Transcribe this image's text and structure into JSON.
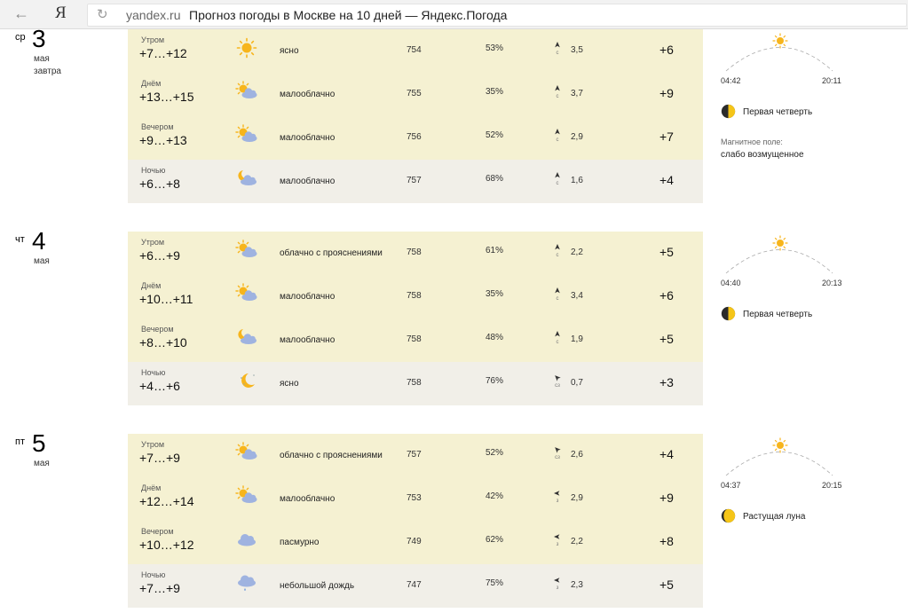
{
  "browser": {
    "back_icon": "back-arrow-icon",
    "logo": "Я",
    "reload_icon": "reload-icon",
    "domain": "yandex.ru",
    "title": "Прогноз погоды в Москве на 10 дней — Яндекс.Погода"
  },
  "days": [
    {
      "dow": "ср",
      "num": "3",
      "month": "мая",
      "sub": "завтра",
      "rows": [
        {
          "name": "Утром",
          "temp": "+7…+12",
          "icon": "sun",
          "cond": "ясно",
          "press": "754",
          "hum": "53%",
          "wind_dir": "с",
          "wind_speed": "3,5",
          "feels": "+6"
        },
        {
          "name": "Днём",
          "temp": "+13…+15",
          "icon": "partly-cloudy",
          "cond": "малооблачно",
          "press": "755",
          "hum": "35%",
          "wind_dir": "с",
          "wind_speed": "3,7",
          "feels": "+9"
        },
        {
          "name": "Вечером",
          "temp": "+9…+13",
          "icon": "partly-cloudy",
          "cond": "малооблачно",
          "press": "756",
          "hum": "52%",
          "wind_dir": "с",
          "wind_speed": "2,9",
          "feels": "+7"
        },
        {
          "name": "Ночью",
          "temp": "+6…+8",
          "icon": "night-cloudy",
          "cond": "малооблачно",
          "press": "757",
          "hum": "68%",
          "wind_dir": "с",
          "wind_speed": "1,6",
          "feels": "+4"
        }
      ],
      "side": {
        "sunrise": "04:42",
        "sunset": "20:11",
        "moon": "Первая четверть",
        "moon_icon": "moon-first-quarter",
        "mag_label": "Магнитное поле:",
        "mag_value": "слабо возмущенное"
      }
    },
    {
      "dow": "чт",
      "num": "4",
      "month": "мая",
      "sub": "",
      "rows": [
        {
          "name": "Утром",
          "temp": "+6…+9",
          "icon": "partly-cloudy",
          "cond": "облачно с прояснениями",
          "press": "758",
          "hum": "61%",
          "wind_dir": "с",
          "wind_speed": "2,2",
          "feels": "+5"
        },
        {
          "name": "Днём",
          "temp": "+10…+11",
          "icon": "partly-cloudy",
          "cond": "малооблачно",
          "press": "758",
          "hum": "35%",
          "wind_dir": "с",
          "wind_speed": "3,4",
          "feels": "+6"
        },
        {
          "name": "Вечером",
          "temp": "+8…+10",
          "icon": "night-cloudy",
          "cond": "малооблачно",
          "press": "758",
          "hum": "48%",
          "wind_dir": "с",
          "wind_speed": "1,9",
          "feels": "+5"
        },
        {
          "name": "Ночью",
          "temp": "+4…+6",
          "icon": "moon",
          "cond": "ясно",
          "press": "758",
          "hum": "76%",
          "wind_dir": "сз",
          "wind_speed": "0,7",
          "feels": "+3"
        }
      ],
      "side": {
        "sunrise": "04:40",
        "sunset": "20:13",
        "moon": "Первая четверть",
        "moon_icon": "moon-first-quarter",
        "mag_label": "",
        "mag_value": ""
      }
    },
    {
      "dow": "пт",
      "num": "5",
      "month": "мая",
      "sub": "",
      "rows": [
        {
          "name": "Утром",
          "temp": "+7…+9",
          "icon": "partly-cloudy",
          "cond": "облачно с прояснениями",
          "press": "757",
          "hum": "52%",
          "wind_dir": "сз",
          "wind_speed": "2,6",
          "feels": "+4"
        },
        {
          "name": "Днём",
          "temp": "+12…+14",
          "icon": "partly-cloudy",
          "cond": "малооблачно",
          "press": "753",
          "hum": "42%",
          "wind_dir": "з",
          "wind_speed": "2,9",
          "feels": "+9"
        },
        {
          "name": "Вечером",
          "temp": "+10…+12",
          "icon": "cloud",
          "cond": "пасмурно",
          "press": "749",
          "hum": "62%",
          "wind_dir": "з",
          "wind_speed": "2,2",
          "feels": "+8"
        },
        {
          "name": "Ночью",
          "temp": "+7…+9",
          "icon": "rain",
          "cond": "небольшой дождь",
          "press": "747",
          "hum": "75%",
          "wind_dir": "з",
          "wind_speed": "2,3",
          "feels": "+5"
        }
      ],
      "side": {
        "sunrise": "04:37",
        "sunset": "20:15",
        "moon": "Растущая луна",
        "moon_icon": "moon-waxing",
        "mag_label": "",
        "mag_value": ""
      }
    }
  ]
}
